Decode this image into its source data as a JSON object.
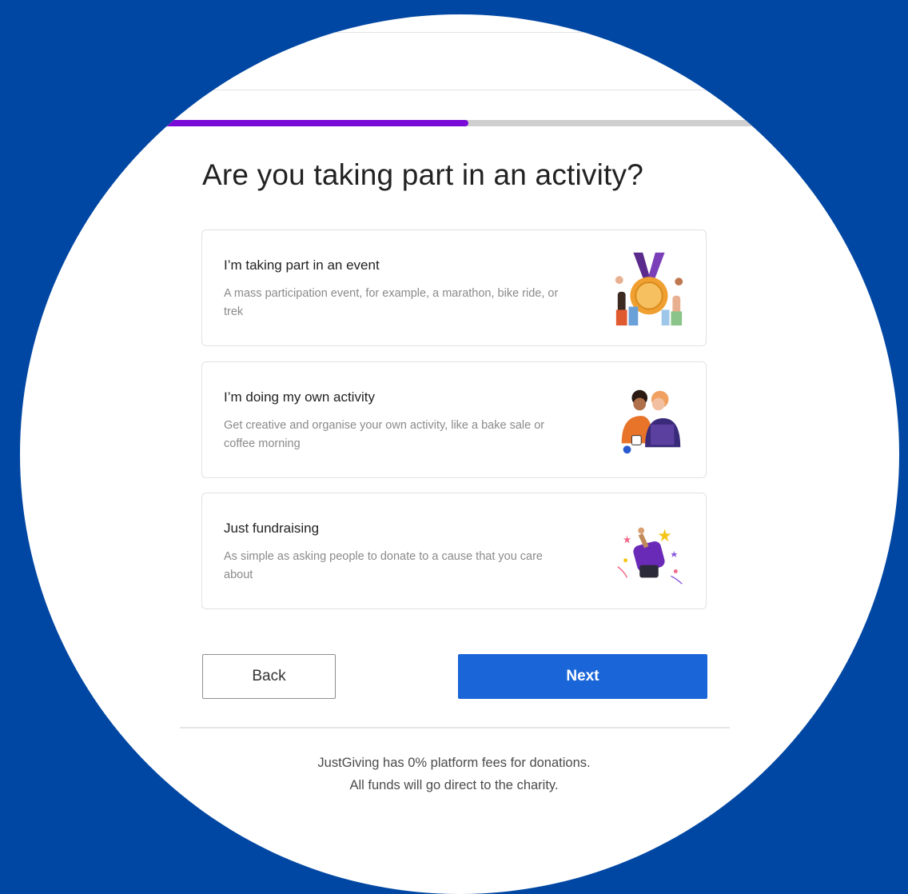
{
  "progress": {
    "fraction": 0.51
  },
  "page": {
    "title": "Are you taking part in an activity?"
  },
  "options": [
    {
      "title": "I’m taking part in an event",
      "description": "A mass participation event, for example, a marathon, bike ride, or trek",
      "icon": "medal-illustration"
    },
    {
      "title": "I’m doing my own activity",
      "description": "Get creative and organise your own activity, like a bake sale or coffee morning",
      "icon": "people-hugging-illustration"
    },
    {
      "title": "Just fundraising",
      "description": "As simple as asking people to donate to a cause that you care about",
      "icon": "donation-illustration"
    }
  ],
  "buttons": {
    "back": "Back",
    "next": "Next"
  },
  "footer": {
    "line1": "JustGiving has 0% platform fees for donations.",
    "line2": "All funds will go direct to the charity."
  },
  "colors": {
    "background": "#0047a3",
    "progress": "#7a0bd6",
    "primary_button": "#1a66d9"
  }
}
